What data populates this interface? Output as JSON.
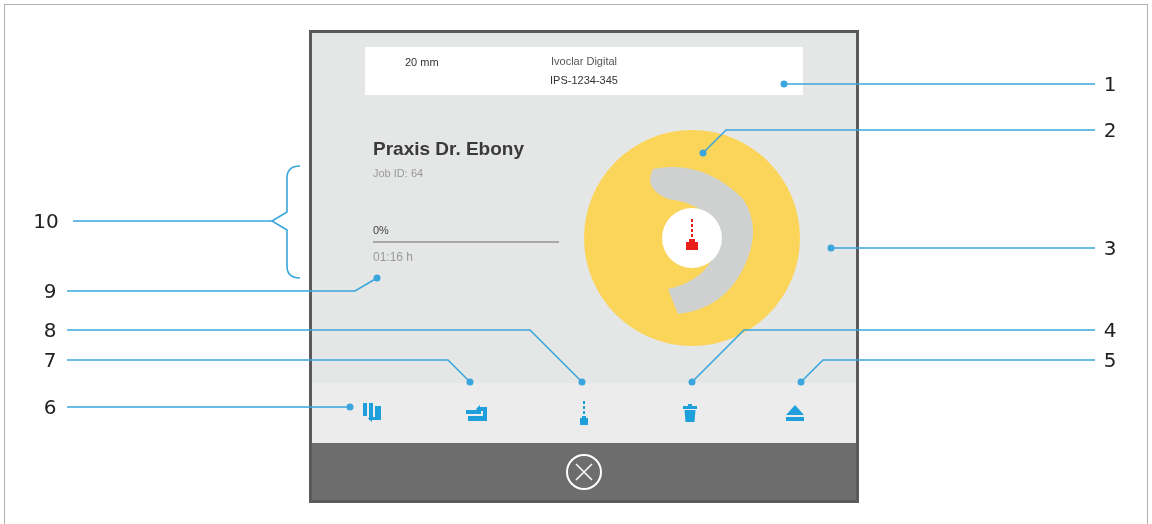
{
  "screen": {
    "header": {
      "thickness": "20 mm",
      "manufacturer": "Ivoclar Digital",
      "part_number": "IPS-1234-345"
    },
    "job": {
      "customer": "Praxis Dr. Ebony",
      "job_id": "Job ID: 64",
      "progress_text": "0%",
      "remaining_time": "01:16 h"
    },
    "toolbar": [
      {
        "kind": "sort"
      },
      {
        "kind": "queue"
      },
      {
        "kind": "mill"
      },
      {
        "kind": "delete"
      },
      {
        "kind": "eject"
      }
    ]
  },
  "left_callouts": [
    {
      "label": "10"
    },
    {
      "label": "9"
    },
    {
      "label": "8"
    },
    {
      "label": "7"
    },
    {
      "label": "6"
    }
  ],
  "right_callouts": [
    {
      "label": "1"
    },
    {
      "label": "2"
    },
    {
      "label": "3"
    },
    {
      "label": "4"
    },
    {
      "label": "5"
    }
  ]
}
